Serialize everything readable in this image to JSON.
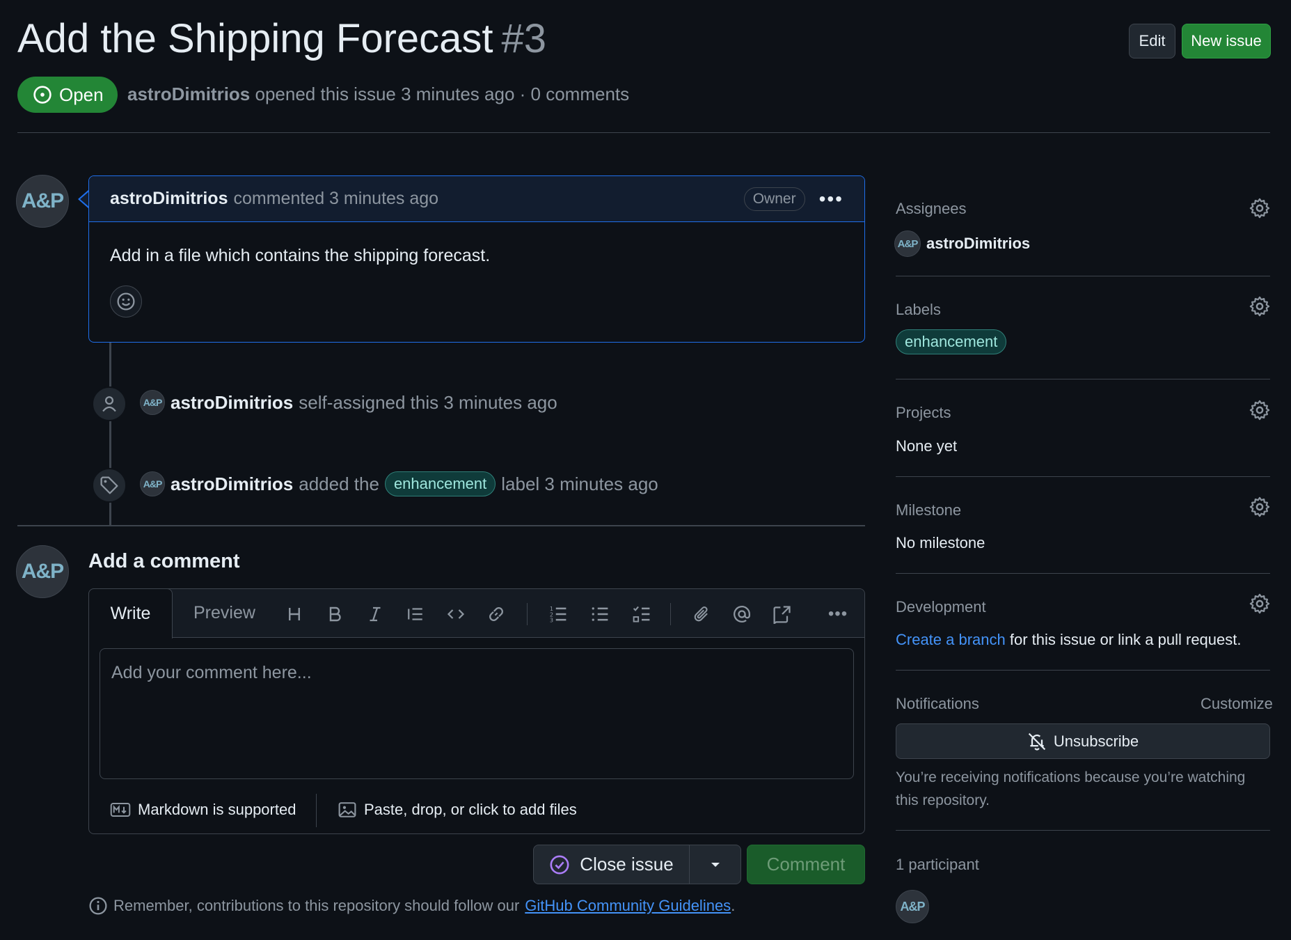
{
  "header": {
    "title": "Add the Shipping Forecast",
    "number": "#3",
    "edit_label": "Edit",
    "new_issue_label": "New issue",
    "state": "Open",
    "author": "astroDimitrios",
    "meta_text": "opened this issue 3 minutes ago · 0 comments"
  },
  "avatar_text": "A&P",
  "comment": {
    "author": "astroDimitrios",
    "action": "commented 3 minutes ago",
    "role": "Owner",
    "body": "Add in a file which contains the shipping forecast."
  },
  "timeline": [
    {
      "icon": "person-icon",
      "author": "astroDimitrios",
      "text": "self-assigned this 3 minutes ago"
    },
    {
      "icon": "tag-icon",
      "author": "astroDimitrios",
      "text_before": "added the",
      "label": "enhancement",
      "text_after": "label 3 minutes ago"
    }
  ],
  "composer": {
    "title": "Add a comment",
    "tab_write": "Write",
    "tab_preview": "Preview",
    "placeholder": "Add your comment here...",
    "markdown_note": "Markdown is supported",
    "files_note": "Paste, drop, or click to add files",
    "close_issue_label": "Close issue",
    "comment_label": "Comment",
    "reminder_text": "Remember, contributions to this repository should follow our",
    "reminder_link": "GitHub Community Guidelines",
    "reminder_end": "."
  },
  "sidebar": {
    "assignees": {
      "heading": "Assignees",
      "value": "astroDimitrios"
    },
    "labels": {
      "heading": "Labels",
      "value": "enhancement"
    },
    "projects": {
      "heading": "Projects",
      "value": "None yet"
    },
    "milestone": {
      "heading": "Milestone",
      "value": "No milestone"
    },
    "development": {
      "heading": "Development",
      "link": "Create a branch",
      "text": "for this issue or link a pull request."
    },
    "notifications": {
      "heading": "Notifications",
      "customize": "Customize",
      "unsubscribe": "Unsubscribe",
      "note": "You’re receiving notifications because you’re watching this repository."
    },
    "participants": {
      "heading": "1 participant"
    }
  },
  "colors": {
    "background": "#0d1117",
    "accent_green": "#238636",
    "link_blue": "#4493f8",
    "label_teal": "#9ee6dd",
    "comment_border": "#1f6feb"
  }
}
